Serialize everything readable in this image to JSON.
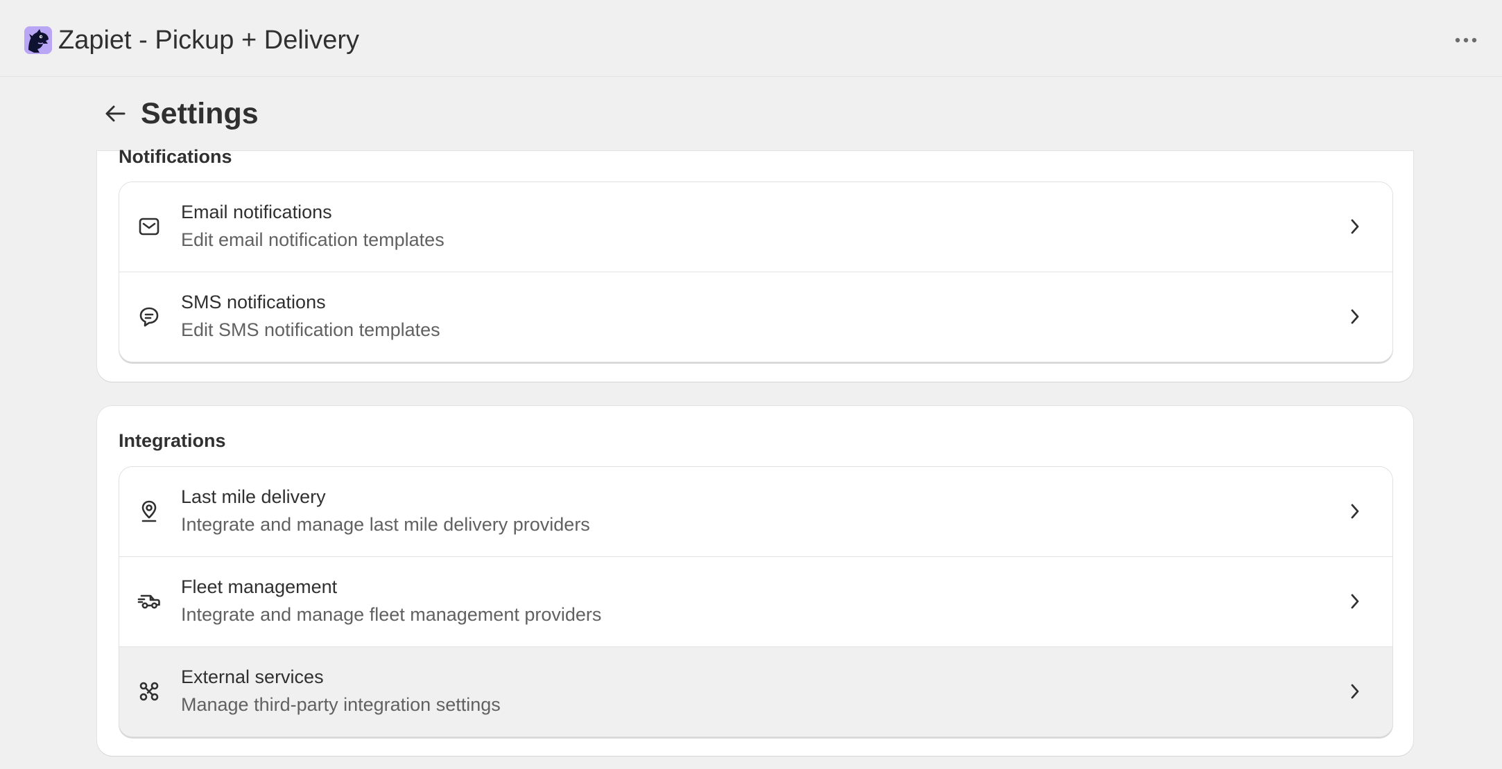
{
  "app": {
    "title": "Zapiet - Pickup + Delivery",
    "logo_icon": "dragon-logo-icon"
  },
  "header": {
    "page_title": "Settings",
    "back_icon": "arrow-left-icon",
    "more_icon": "ellipsis-horizontal-icon"
  },
  "sections": {
    "notifications": {
      "heading": "Notifications",
      "items": [
        {
          "title": "Email notifications",
          "description": "Edit email notification templates",
          "icon": "email-icon"
        },
        {
          "title": "SMS notifications",
          "description": "Edit SMS notification templates",
          "icon": "chat-bubble-icon"
        }
      ]
    },
    "integrations": {
      "heading": "Integrations",
      "items": [
        {
          "title": "Last mile delivery",
          "description": "Integrate and manage last mile delivery providers",
          "icon": "location-pin-icon"
        },
        {
          "title": "Fleet management",
          "description": "Integrate and manage fleet management providers",
          "icon": "delivery-truck-icon"
        },
        {
          "title": "External services",
          "description": "Manage third-party integration settings",
          "icon": "integration-nodes-icon"
        }
      ]
    }
  },
  "colors": {
    "background": "#f1f0f1",
    "card": "#ffffff",
    "text_primary": "#303030",
    "text_secondary": "#616161",
    "logo_accent": "#b9a7f5"
  }
}
